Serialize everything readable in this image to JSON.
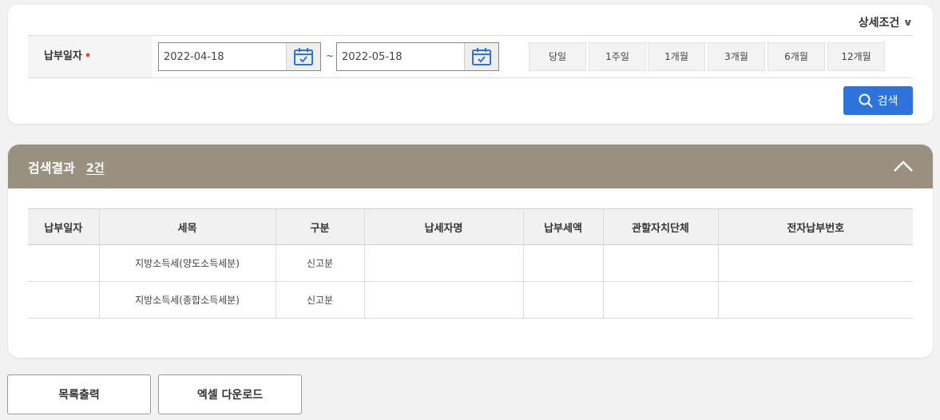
{
  "search": {
    "detail_toggle_label": "상세조건",
    "date_label": "납부일자",
    "required_mark": "•",
    "start_date": "2022-04-18",
    "end_date": "2022-05-18",
    "date_separator": "~",
    "periods": [
      "당일",
      "1주일",
      "1개월",
      "3개월",
      "6개월",
      "12개월"
    ],
    "search_button_label": "검색"
  },
  "results": {
    "title": "검색결과",
    "count_label": "2건",
    "columns": [
      "납부일자",
      "세목",
      "구분",
      "납세자명",
      "납부세액",
      "관할자치단체",
      "전자납부번호"
    ],
    "rows": [
      [
        "",
        "지방소득세(양도소득세분)",
        "신고분",
        "",
        "",
        "",
        ""
      ],
      [
        "",
        "지방소득세(종합소득세분)",
        "신고분",
        "",
        "",
        "",
        ""
      ]
    ]
  },
  "actions": {
    "print_list_label": "목록출력",
    "excel_download_label": "엑셀 다운로드"
  },
  "colors": {
    "accent": "#2e73dc",
    "result_header": "#9a9080",
    "required": "#e8412c"
  },
  "icons": {
    "calendar": "calendar-icon",
    "search": "search-icon",
    "collapse": "chevron-up-icon",
    "detail": "chevron-down-icon"
  }
}
